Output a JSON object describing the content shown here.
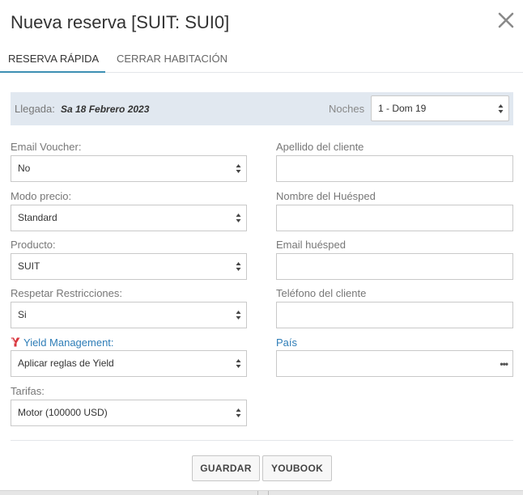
{
  "modal": {
    "title": "Nueva reserva [SUIT: SUI0]"
  },
  "tabs": [
    {
      "label": "RESERVA RÁPIDA",
      "active": true
    },
    {
      "label": "CERRAR HABITACIÓN",
      "active": false
    }
  ],
  "arrival": {
    "label": "Llegada:",
    "date": "Sa 18 Febrero 2023",
    "nights_label": "Noches",
    "nights_value": "1 - Dom 19"
  },
  "left_fields": {
    "email_voucher": {
      "label": "Email Voucher:",
      "value": "No"
    },
    "price_mode": {
      "label": "Modo precio:",
      "value": "Standard"
    },
    "product": {
      "label": "Producto:",
      "value": "SUIT"
    },
    "restrictions": {
      "label": "Respetar Restricciones:",
      "value": "Si"
    },
    "yield": {
      "label": "Yield Management:",
      "value": "Aplicar reglas de Yield"
    },
    "rates": {
      "label": "Tarifas:",
      "value": "Motor (100000 USD)"
    }
  },
  "right_fields": {
    "surname": {
      "label": "Apellido del cliente",
      "value": ""
    },
    "guest_name": {
      "label": "Nombre del Huésped",
      "value": ""
    },
    "guest_email": {
      "label": "Email huésped",
      "value": ""
    },
    "phone": {
      "label": "Teléfono del cliente",
      "value": ""
    },
    "country": {
      "label": "País",
      "value": ""
    }
  },
  "buttons": {
    "save": "GUARDAR",
    "youbook": "YOUBOOK"
  },
  "colors": {
    "accent": "#3d8fb3",
    "link": "#2e7db7",
    "arrival_bg": "#e1e8f0",
    "yield_icon": "#d9363e"
  },
  "icons": {
    "close": "close-icon",
    "yield": "yield-logo-icon",
    "select": "select-arrows-icon",
    "more": "more-dots-icon"
  }
}
